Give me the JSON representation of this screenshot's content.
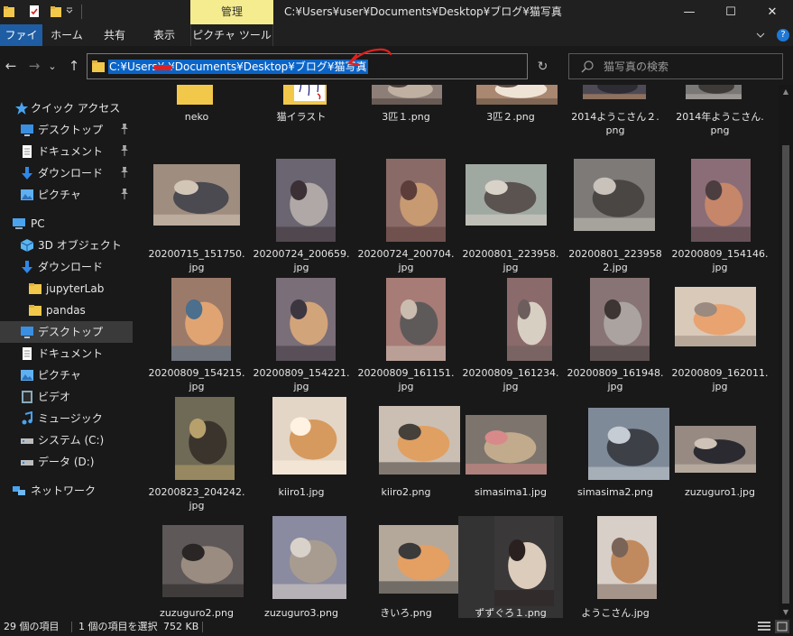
{
  "window": {
    "title": "C:¥Users¥user¥Documents¥Desktop¥ブログ¥猫写真",
    "context_tab": "管理",
    "minimize": "—",
    "maximize": "☐",
    "close": "✕"
  },
  "ribbon": {
    "tabs": [
      "ファイル",
      "ホーム",
      "共有",
      "表示",
      "ピクチャ ツール"
    ],
    "help": "?"
  },
  "nav": {
    "back": "←",
    "forward": "→",
    "recent": "⌄",
    "up": "↑",
    "address": "C:¥Users¥  ¥Documents¥Desktop¥ブログ¥猫写真",
    "refresh": "↻",
    "search_placeholder": "猫写真の検索"
  },
  "sidebar": {
    "quick_access": "クイック アクセス",
    "items": [
      {
        "label": "クイック アクセス",
        "icon": "star-icon"
      },
      {
        "label": "デスクトップ",
        "icon": "desktop-icon",
        "pinned": true
      },
      {
        "label": "ドキュメント",
        "icon": "document-icon",
        "pinned": true
      },
      {
        "label": "ダウンロード",
        "icon": "download-icon",
        "pinned": true
      },
      {
        "label": "ピクチャ",
        "icon": "picture-icon",
        "pinned": true
      },
      {
        "label": "PC",
        "icon": "pc-icon"
      },
      {
        "label": "3D オブジェクト",
        "icon": "cube-icon"
      },
      {
        "label": "ダウンロード",
        "icon": "download-icon"
      },
      {
        "label": "jupyterLab",
        "icon": "folder-icon"
      },
      {
        "label": "pandas",
        "icon": "folder-icon"
      },
      {
        "label": "デスクトップ",
        "icon": "desktop-icon",
        "selected": true
      },
      {
        "label": "ドキュメント",
        "icon": "document-icon"
      },
      {
        "label": "ピクチャ",
        "icon": "picture-icon"
      },
      {
        "label": "ビデオ",
        "icon": "video-icon"
      },
      {
        "label": "ミュージック",
        "icon": "music-icon"
      },
      {
        "label": "システム (C:)",
        "icon": "drive-icon"
      },
      {
        "label": "データ (D:)",
        "icon": "drive-icon"
      },
      {
        "label": "ネットワーク",
        "icon": "network-icon"
      }
    ]
  },
  "files": [
    {
      "name": "neko",
      "kind": "folder"
    },
    {
      "name": "猫イラスト",
      "kind": "folder-illust"
    },
    {
      "name": "3匹１.png",
      "kind": "photo"
    },
    {
      "name": "3匹２.png",
      "kind": "photo"
    },
    {
      "name": "2014ようこさん２.",
      "name2": "png",
      "kind": "photo"
    },
    {
      "name": "2014年ようこさん.",
      "name2": "png",
      "kind": "photo"
    },
    {
      "name": "20200715_151750.",
      "name2": "jpg",
      "kind": "photo"
    },
    {
      "name": "20200724_200659.",
      "name2": "jpg",
      "kind": "photo"
    },
    {
      "name": "20200724_200704.",
      "name2": "jpg",
      "kind": "photo"
    },
    {
      "name": "20200801_223958.",
      "name2": "jpg",
      "kind": "photo"
    },
    {
      "name": "20200801_223958",
      "name2": "2.jpg",
      "kind": "photo"
    },
    {
      "name": "20200809_154146.",
      "name2": "jpg",
      "kind": "photo"
    },
    {
      "name": "20200809_154215.",
      "name2": "jpg",
      "kind": "photo"
    },
    {
      "name": "20200809_154221.",
      "name2": "jpg",
      "kind": "photo"
    },
    {
      "name": "20200809_161151.",
      "name2": "jpg",
      "kind": "photo"
    },
    {
      "name": "20200809_161234.",
      "name2": "jpg",
      "kind": "photo"
    },
    {
      "name": "20200809_161948.",
      "name2": "jpg",
      "kind": "photo"
    },
    {
      "name": "20200809_162011.",
      "name2": "jpg",
      "kind": "photo"
    },
    {
      "name": "20200823_204242.",
      "name2": "jpg",
      "kind": "photo"
    },
    {
      "name": "kiiro1.jpg",
      "kind": "photo"
    },
    {
      "name": "kiiro2.png",
      "kind": "photo"
    },
    {
      "name": "simasima1.jpg",
      "kind": "photo"
    },
    {
      "name": "simasima2.png",
      "kind": "photo"
    },
    {
      "name": "zuzuguro1.jpg",
      "kind": "photo"
    },
    {
      "name": "zuzuguro2.png",
      "kind": "photo"
    },
    {
      "name": "zuzuguro3.png",
      "kind": "photo"
    },
    {
      "name": "きいろ.png",
      "kind": "photo"
    },
    {
      "name": "ずずぐろ１.png",
      "kind": "photo",
      "selected": true
    },
    {
      "name": "ようこさん.jpg",
      "kind": "photo"
    }
  ],
  "status": {
    "count": "29 個の項目",
    "selection": "1 個の項目を選択",
    "size": "752 KB"
  },
  "colors": {
    "accent": "#0a64c8",
    "file_tab": "#1e5da3",
    "context_tab": "#f4ec8f",
    "folder": "#f2c84b",
    "annotation_arrow": "#e02020"
  }
}
